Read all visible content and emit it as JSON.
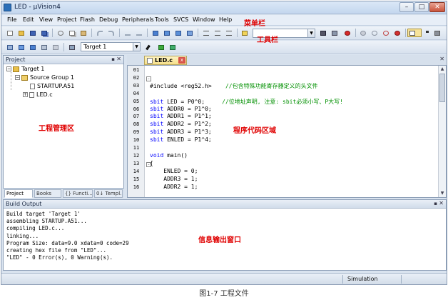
{
  "window": {
    "title": "LED - µVision4",
    "min_glyph": "–",
    "max_glyph": "□",
    "close_glyph": "✕"
  },
  "menu": {
    "items": [
      "File",
      "Edit",
      "View",
      "Project",
      "Flash",
      "Debug",
      "Peripherals",
      "Tools",
      "SVCS",
      "Window",
      "Help"
    ]
  },
  "toolbar2": {
    "target_select": "Target 1"
  },
  "annotations": {
    "menubar": "菜单栏",
    "toolbar": "工具栏",
    "project_area": "工程管理区",
    "code_area": "程序代码区域",
    "output_area": "信息输出窗口"
  },
  "project_pane": {
    "title": "Project",
    "pin": "▪",
    "close": "✕",
    "tree": {
      "target": "Target 1",
      "group": "Source Group 1",
      "files": [
        "STARTUP.A51",
        "LED.c"
      ]
    },
    "tabs": [
      "Project",
      "Books",
      "{} Functi...",
      "0↓ Templ..."
    ]
  },
  "editor": {
    "tab_label": "LED.c",
    "tab_close": "x",
    "close": "✕",
    "scroll_up": "▲",
    "scroll_down": "▼",
    "line_numbers": [
      "01",
      "02",
      "03",
      "04",
      "05",
      "06",
      "07",
      "08",
      "09",
      "10",
      "11",
      "12",
      "13",
      "14",
      "15",
      "16"
    ],
    "lines": [
      {
        "n": "01",
        "parts": []
      },
      {
        "n": "02",
        "parts": [],
        "fold": "-"
      },
      {
        "n": "03",
        "parts": [
          {
            "c": "",
            "t": "#include <reg52.h>    "
          },
          {
            "c": "cm",
            "t": "//包含特殊功能寄存器定义的头文件"
          }
        ]
      },
      {
        "n": "04",
        "parts": []
      },
      {
        "n": "05",
        "parts": [
          {
            "c": "kw",
            "t": "sbit"
          },
          {
            "c": "",
            "t": " LED = P0^0;     "
          },
          {
            "c": "cm",
            "t": "//位地址声明, 注意: sbit必须小写、P大写!"
          }
        ]
      },
      {
        "n": "06",
        "parts": [
          {
            "c": "kw",
            "t": "sbit"
          },
          {
            "c": "",
            "t": " ADDR0 = P1^0;"
          }
        ]
      },
      {
        "n": "07",
        "parts": [
          {
            "c": "kw",
            "t": "sbit"
          },
          {
            "c": "",
            "t": " ADDR1 = P1^1;"
          }
        ]
      },
      {
        "n": "08",
        "parts": [
          {
            "c": "kw",
            "t": "sbit"
          },
          {
            "c": "",
            "t": " ADDR2 = P1^2;"
          }
        ]
      },
      {
        "n": "09",
        "parts": [
          {
            "c": "kw",
            "t": "sbit"
          },
          {
            "c": "",
            "t": " ADDR3 = P1^3;"
          }
        ]
      },
      {
        "n": "10",
        "parts": [
          {
            "c": "kw",
            "t": "sbit"
          },
          {
            "c": "",
            "t": " ENLED = P1^4;"
          }
        ]
      },
      {
        "n": "11",
        "parts": []
      },
      {
        "n": "12",
        "parts": [
          {
            "c": "kw",
            "t": "void"
          },
          {
            "c": "",
            "t": " main()"
          }
        ]
      },
      {
        "n": "13",
        "parts": [
          {
            "c": "",
            "t": "{"
          }
        ],
        "fold": "-"
      },
      {
        "n": "14",
        "parts": [
          {
            "c": "",
            "t": "    ENLED = 0;"
          }
        ]
      },
      {
        "n": "15",
        "parts": [
          {
            "c": "",
            "t": "    ADDR3 = 1;"
          }
        ]
      },
      {
        "n": "16",
        "parts": [
          {
            "c": "",
            "t": "    ADDR2 = 1;"
          }
        ]
      }
    ]
  },
  "build_output": {
    "title": "Build Output",
    "pin": "▪",
    "close": "✕",
    "lines": [
      "Build target 'Target 1'",
      "assembling STARTUP.A51...",
      "compiling LED.c...",
      "linking...",
      "Program Size: data=9.0 xdata=0 code=29",
      "creating hex file from \"LED\"...",
      "\"LED\" - 0 Error(s), 0 Warning(s)."
    ]
  },
  "statusbar": {
    "mode": "Simulation"
  },
  "caption": "图1-7 工程文件",
  "colors": {
    "annotation": "#e00000",
    "keyword": "#0000ff",
    "comment": "#009000",
    "chrome": "#d9e3ef"
  }
}
